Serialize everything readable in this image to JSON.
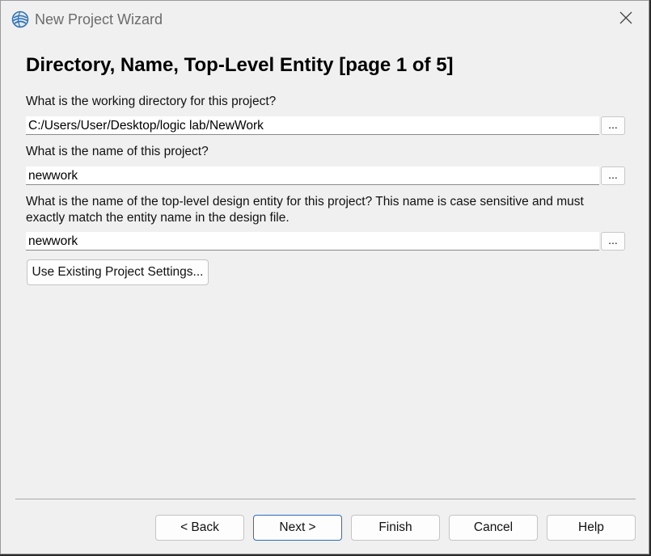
{
  "window": {
    "title": "New Project Wizard"
  },
  "page": {
    "heading": "Directory, Name, Top-Level Entity [page 1 of 5]"
  },
  "fields": {
    "working_directory": {
      "label": "What is the working directory for this project?",
      "value": "C:/Users/User/Desktop/logic lab/NewWork",
      "browse_label": "..."
    },
    "project_name": {
      "label": "What is the name of this project?",
      "value": "newwork",
      "browse_label": "..."
    },
    "top_level_entity": {
      "label": "What is the name of the top-level design entity for this project? This name is case sensitive and must exactly match the entity name in the design file.",
      "value": "newwork",
      "browse_label": "..."
    }
  },
  "use_existing_label": "Use Existing Project Settings...",
  "footer": {
    "back_label": "< Back",
    "next_label": "Next >",
    "finish_label": "Finish",
    "cancel_label": "Cancel",
    "help_label": "Help"
  },
  "icons": {
    "app": "quartus-globe-icon",
    "close": "close-icon"
  },
  "colors": {
    "window_bg": "#f0f0f0",
    "primary_border": "#2a6ec0",
    "icon_blue": "#2f6fb0"
  }
}
